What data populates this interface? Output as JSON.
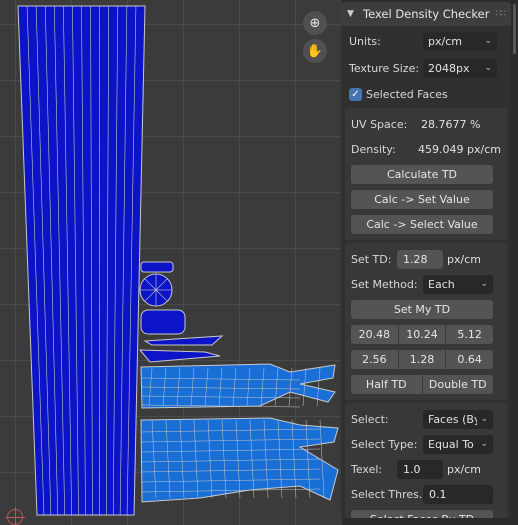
{
  "viewport": {
    "zoom_icon": "zoom-in-icon",
    "pan_icon": "hand-icon",
    "origin_icon": "cursor-origin-icon"
  },
  "panel": {
    "title": "Texel Density Checker",
    "units_label": "Units:",
    "units_value": "px/cm",
    "texture_size_label": "Texture Size:",
    "texture_size_value": "2048px",
    "selected_faces_label": "Selected Faces",
    "selected_faces_checked": true,
    "uv_space_label": "UV Space:",
    "uv_space_value": "28.7677 %",
    "density_label": "Density:",
    "density_value": "459.049 px/cm",
    "calculate_td": "Calculate TD",
    "calc_set_value": "Calc -> Set Value",
    "calc_select_value": "Calc -> Select Value",
    "set_td_label": "Set TD:",
    "set_td_value": "1.28",
    "set_td_unit": "px/cm",
    "set_method_label": "Set Method:",
    "set_method_value": "Each",
    "set_my_td": "Set My TD",
    "presets": [
      "20.48",
      "10.24",
      "5.12",
      "2.56",
      "1.28",
      "0.64"
    ],
    "half_td": "Half TD",
    "double_td": "Double TD",
    "select_label": "Select:",
    "select_value": "Faces (By...",
    "select_type_label": "Select Type:",
    "select_type_value": "Equal To",
    "texel_label": "Texel:",
    "texel_value": "1.0",
    "texel_unit": "px/cm",
    "select_threshold_label": "Select Thres...",
    "select_threshold_value": "0.1",
    "select_faces_by_td": "Select Faces By TD"
  },
  "colors": {
    "uv_fill_dark": "#0c14c8",
    "uv_fill_light": "#1a6fd6",
    "uv_wire": "#c8c8c8",
    "accent": "#4772b3"
  }
}
